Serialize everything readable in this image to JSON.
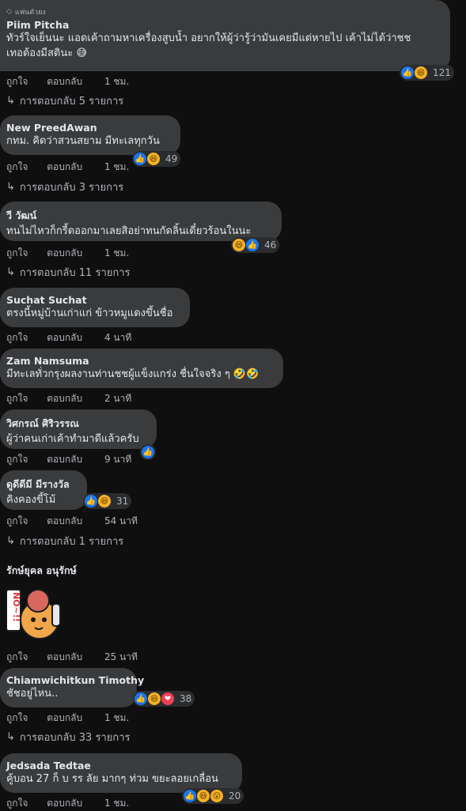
{
  "comments": [
    {
      "badge": "แฟนตัวยง",
      "name": "Piim Pitcha",
      "lines": [
        "ทัวร์ใจเย็นนะ แอดเค้าถามหาเครื่องสูบน้ำ อยากให้ผู้ว่ารู้ว่ามันเคยมีแต่หายไป เค้าไม่ได้ว่าชช",
        "เทอต้องมีสตินะ 😅"
      ],
      "like": "ถูกใจ",
      "reply": "ตอบกลับ",
      "time": "1 ชม.",
      "reaction_count": "121",
      "replies": "การตอบกลับ 5 รายการ"
    },
    {
      "name": "New PreedAwan",
      "lines": [
        "กทม. คิดว่าสวนสยาม มีทะเลทุกวัน"
      ],
      "like": "ถูกใจ",
      "reply": "ตอบกลับ",
      "time": "1 ชม.",
      "reaction_count": "49",
      "replies": "การตอบกลับ 3 รายการ"
    },
    {
      "name": "วี วัฒน์",
      "lines": [
        "ทนไม่ไหวก็กรี้ดออกมาเลยสิอย่าทนกัดลิ้นเดี๋ยวร้อนในนะ"
      ],
      "like": "ถูกใจ",
      "reply": "ตอบกลับ",
      "time": "1 ชม.",
      "reaction_count": "46",
      "replies": "การตอบกลับ 11 รายการ"
    },
    {
      "name": "Suchat Suchat",
      "lines": [
        "ตรงนี้หมู่บ้านเก่าแก่ ข้าวหมูแดงขึ้นชื่อ"
      ],
      "like": "ถูกใจ",
      "reply": "ตอบกลับ",
      "time": "4 นาที"
    },
    {
      "name": "Zam Namsuma",
      "lines": [
        "มีทะเลทั่วกรุงผลงานท่านชชผู้แข็งแกร่ง ชื่นใจจริง ๆ 🤣🤣"
      ],
      "like": "ถูกใจ",
      "reply": "ตอบกลับ",
      "time": "2 นาที"
    },
    {
      "name": "วิศกรณ์ ศิริวรรณ",
      "lines": [
        "ผู้ว่าคนเก่าเค้าทำมาดีแล้วครับ"
      ],
      "like": "ถูกใจ",
      "reply": "ตอบกลับ",
      "time": "9 นาที"
    },
    {
      "name": "ดูดีดีมี มีรางวัล",
      "lines": [
        "คิงคองขี้โม้"
      ],
      "like": "ถูกใจ",
      "reply": "ตอบกลับ",
      "time": "54 นาที",
      "reaction_count": "31",
      "replies": "การตอบกลับ 1 รายการ"
    },
    {
      "name": "รักษ์ยุคล อนุรักษ์",
      "sticker_text": "NO~!!",
      "like": "ถูกใจ",
      "reply": "ตอบกลับ",
      "time": "25 นาที"
    },
    {
      "name": "Chiamwichitkun Timothy",
      "lines": [
        "ชัชอยู่ไหน.."
      ],
      "like": "ถูกใจ",
      "reply": "ตอบกลับ",
      "time": "1 ชม.",
      "reaction_count": "38",
      "replies": "การตอบกลับ 33 รายการ"
    },
    {
      "name": "Jedsada Tedtae",
      "lines": [
        "คู้บอน 27 ก็ บ รร ลัย มากๆ ท่วม ขยะลอยเกลื่อน"
      ],
      "like": "ถูกใจ",
      "reply": "ตอบกลับ",
      "time": "1 ชม.",
      "reaction_count": "20"
    }
  ],
  "icons": {
    "like": "👍",
    "haha": "😆",
    "love": "❤",
    "wow": "😮",
    "diamond": "◇",
    "reply_arrow": "↳"
  }
}
